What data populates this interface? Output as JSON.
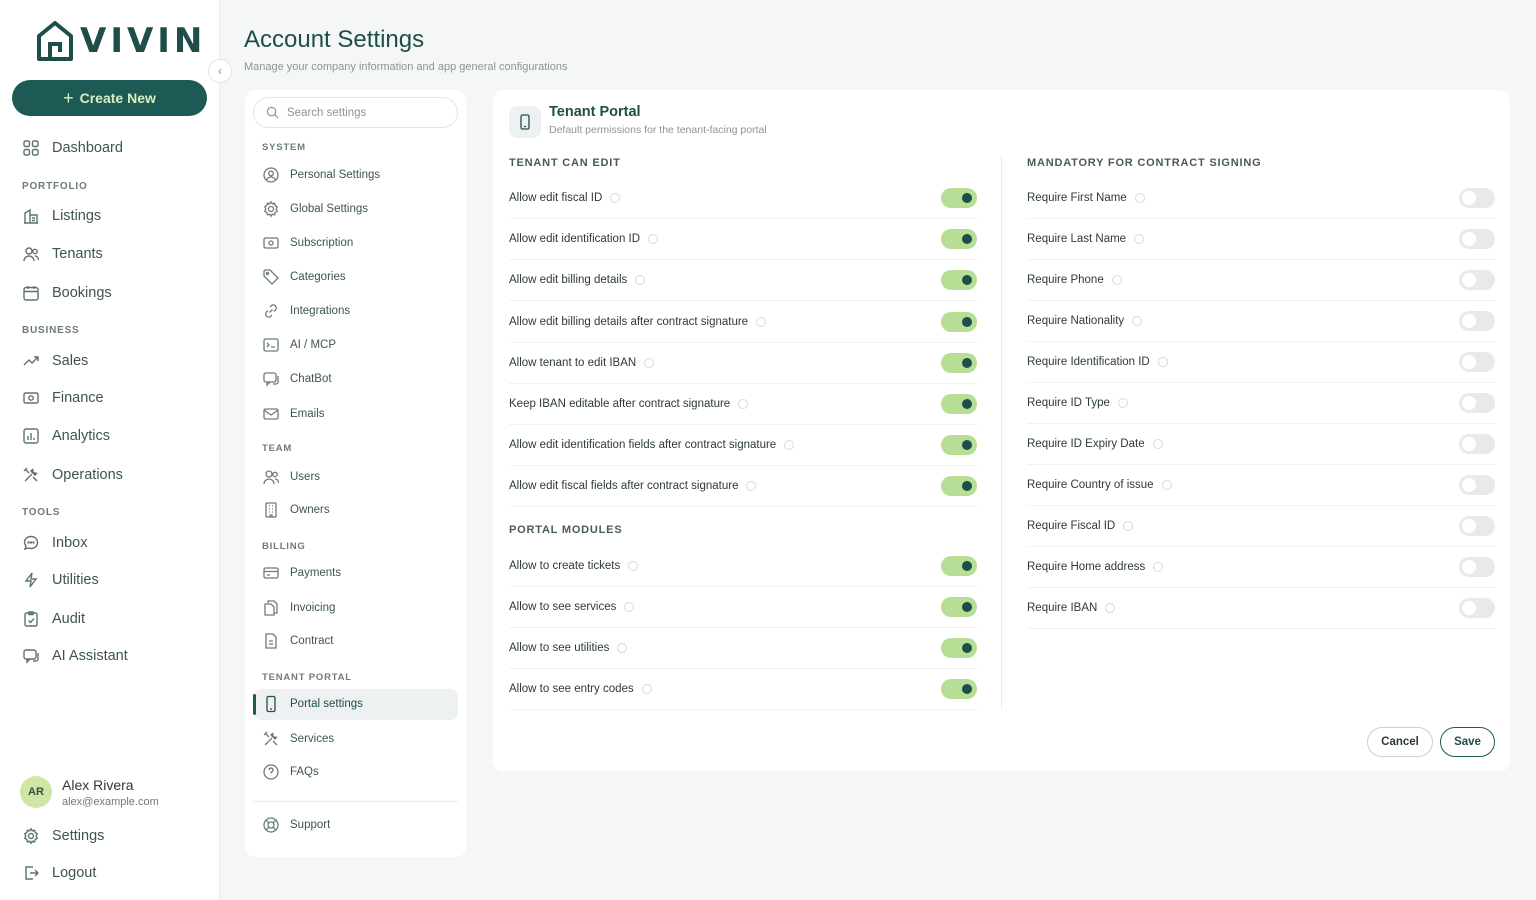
{
  "brand": {
    "name": "VIVIN"
  },
  "sidebar": {
    "create_label": "Create New",
    "dashboard": "Dashboard",
    "sec_portfolio": "PORTFOLIO",
    "listings": "Listings",
    "tenants": "Tenants",
    "bookings": "Bookings",
    "sec_business": "BUSINESS",
    "sales": "Sales",
    "finance": "Finance",
    "analytics": "Analytics",
    "operations": "Operations",
    "sec_tools": "TOOLS",
    "inbox": "Inbox",
    "utilities": "Utilities",
    "audit": "Audit",
    "ai_assistant": "AI Assistant",
    "settings": "Settings",
    "logout": "Logout"
  },
  "user": {
    "initials": "AR",
    "name": "Alex Rivera",
    "email": "alex@example.com"
  },
  "page": {
    "title": "Account Settings",
    "subtitle": "Manage your company information and app general configurations"
  },
  "settings_nav": {
    "search_placeholder": "Search settings",
    "sec_system": "SYSTEM",
    "personal": "Personal Settings",
    "global": "Global Settings",
    "subscription": "Subscription",
    "categories": "Categories",
    "integrations": "Integrations",
    "ai_mcp": "AI / MCP",
    "chatbot": "ChatBot",
    "emails": "Emails",
    "sec_team": "TEAM",
    "users": "Users",
    "owners": "Owners",
    "sec_billing": "BILLING",
    "payments": "Payments",
    "invoicing": "Invoicing",
    "contract": "Contract",
    "sec_tenant_portal": "TENANT PORTAL",
    "portal_settings": "Portal settings",
    "services": "Services",
    "faqs": "FAQs",
    "support": "Support"
  },
  "card": {
    "title": "Tenant Portal",
    "subtitle": "Default permissions for the tenant-facing portal",
    "tenant_can_edit_head": "TENANT CAN EDIT",
    "tenant_can_edit": [
      {
        "label": "Allow edit fiscal ID",
        "on": true
      },
      {
        "label": "Allow edit identification ID",
        "on": true
      },
      {
        "label": "Allow edit billing details",
        "on": true
      },
      {
        "label": "Allow edit billing details after contract signature",
        "on": true
      },
      {
        "label": "Allow tenant to edit IBAN",
        "on": true
      },
      {
        "label": "Keep IBAN editable after contract signature",
        "on": true
      },
      {
        "label": "Allow edit identification fields after contract signature",
        "on": true
      },
      {
        "label": "Allow edit fiscal fields after contract signature",
        "on": true
      }
    ],
    "portal_modules_head": "PORTAL MODULES",
    "portal_modules": [
      {
        "label": "Allow to create tickets",
        "on": true
      },
      {
        "label": "Allow to see services",
        "on": true
      },
      {
        "label": "Allow to see utilities",
        "on": true
      },
      {
        "label": "Allow to see entry codes",
        "on": true
      }
    ],
    "mandatory_head": "MANDATORY FOR CONTRACT SIGNING",
    "mandatory": [
      {
        "label": "Require First Name",
        "on": false
      },
      {
        "label": "Require Last Name",
        "on": false
      },
      {
        "label": "Require Phone",
        "on": false
      },
      {
        "label": "Require Nationality",
        "on": false
      },
      {
        "label": "Require Identification ID",
        "on": false
      },
      {
        "label": "Require ID Type",
        "on": false
      },
      {
        "label": "Require ID Expiry Date",
        "on": false
      },
      {
        "label": "Require Country of issue",
        "on": false
      },
      {
        "label": "Require Fiscal ID",
        "on": false
      },
      {
        "label": "Require Home address",
        "on": false
      },
      {
        "label": "Require IBAN",
        "on": false
      }
    ],
    "cancel_label": "Cancel",
    "save_label": "Save"
  },
  "colors": {
    "brand": "#1e5a55",
    "toggle_on": "#b6de94",
    "toggle_off": "#e8eaea"
  }
}
